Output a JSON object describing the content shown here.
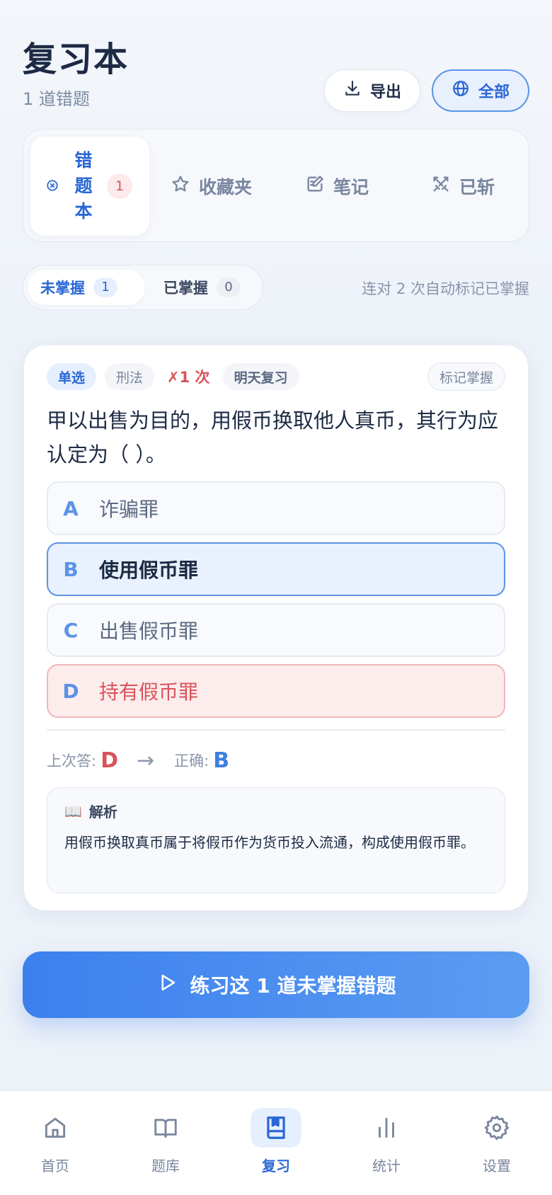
{
  "header": {
    "title": "复习本",
    "subtitle": "1 道错题",
    "export_label": "导出",
    "all_label": "全部"
  },
  "tabs": {
    "active": {
      "label_chars": [
        "错",
        "题",
        "本"
      ],
      "count": "1",
      "icon": "circle-x-icon"
    },
    "items": [
      {
        "label": "收藏夹",
        "icon": "star-icon"
      },
      {
        "label": "笔记",
        "icon": "note-edit-icon"
      },
      {
        "label": "已斩",
        "icon": "crossed-swords-icon"
      }
    ]
  },
  "mastery": {
    "unmastered_label": "未掌握",
    "unmastered_count": "1",
    "mastered_label": "已掌握",
    "mastered_count": "0",
    "hint": "连对 2 次自动标记已掌握"
  },
  "question": {
    "type_tag": "单选",
    "subject_tag": "刑法",
    "wrong_count": "✗1 次",
    "review_tag": "明天复习",
    "mark_label": "标记掌握",
    "stem": "甲以出售为目的，用假币换取他人真币，其行为应认定为（ ）。",
    "options": [
      {
        "letter": "A",
        "text": "诈骗罪",
        "state": "normal"
      },
      {
        "letter": "B",
        "text": "使用假币罪",
        "state": "correct"
      },
      {
        "letter": "C",
        "text": "出售假币罪",
        "state": "normal"
      },
      {
        "letter": "D",
        "text": "持有假币罪",
        "state": "wrong"
      }
    ],
    "last_answer_label": "上次答:",
    "last_answer": "D",
    "arrow": "→",
    "correct_label": "正确:",
    "correct_answer": "B",
    "explanation_icon": "📖",
    "explanation_title": "解析",
    "explanation_text": "用假币换取真币属于将假币作为货币投入流通，构成使用假币罪。"
  },
  "practice_label": "练习这 1 道未掌握错题",
  "nav": {
    "items": [
      {
        "label": "首页",
        "icon": "home-icon"
      },
      {
        "label": "题库",
        "icon": "book-open-icon"
      },
      {
        "label": "复习",
        "icon": "bookmark-book-icon",
        "active": true
      },
      {
        "label": "统计",
        "icon": "bar-chart-icon"
      },
      {
        "label": "设置",
        "icon": "gear-icon"
      }
    ]
  },
  "colors": {
    "accent": "#2a67d4",
    "danger": "#d9535b",
    "background": "#f1f4fa"
  }
}
